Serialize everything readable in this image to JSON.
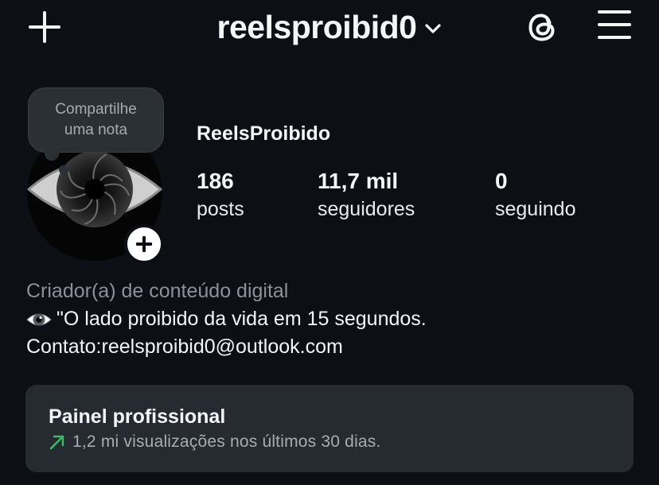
{
  "header": {
    "username": "reelsproibid0",
    "icons": {
      "create": "plus-icon",
      "account_switch": "chevron-down-icon",
      "threads": "threads-icon",
      "menu": "hamburger-menu-icon"
    }
  },
  "note": {
    "text": "Compartilhe\numa nota"
  },
  "profile": {
    "display_name": "ReelsProibido",
    "stats": {
      "posts": {
        "value": "186",
        "label": "posts"
      },
      "followers": {
        "value": "11,7 mil",
        "label": "seguidores"
      },
      "following": {
        "value": "0",
        "label": "seguindo"
      }
    }
  },
  "bio": {
    "category": "Criador(a) de conteúdo digital",
    "line1": "\"O lado proibido da vida em 15 segundos.",
    "line2": "Contato:reelsproibid0@outlook.com",
    "emoji": "eye-emoji"
  },
  "dashboard": {
    "title": "Painel profissional",
    "subtitle": "1,2 mi visualizações nos últimos 30 dias.",
    "trend_color": "#3dbb6b"
  },
  "colors": {
    "background": "#0c0f14",
    "card": "#262a31",
    "text_primary": "#f4f5f7",
    "text_secondary": "#8b9099"
  }
}
